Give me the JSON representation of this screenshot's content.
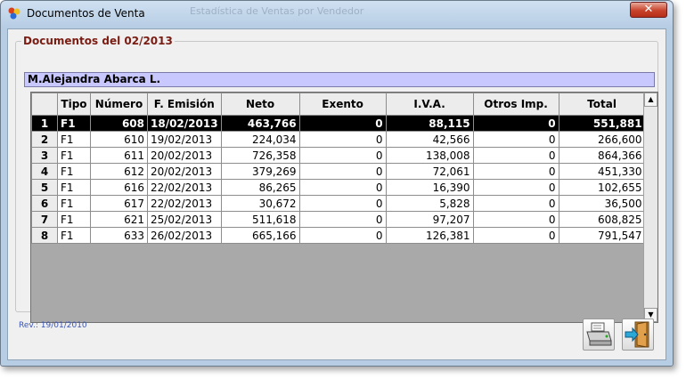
{
  "window": {
    "title": "Documentos de Venta",
    "ghost_title": "Estadística de Ventas por Vendedor"
  },
  "group": {
    "legend": "Documentos del 02/2013"
  },
  "vendor_name": "M.Alejandra Abarca L.",
  "table": {
    "headers": [
      "Tipo",
      "Número",
      "F. Emisión",
      "Neto",
      "Exento",
      "I.V.A.",
      "Otros Imp.",
      "Total"
    ],
    "rows": [
      [
        "1",
        "F1",
        "608",
        "18/02/2013",
        "463,766",
        "0",
        "88,115",
        "0",
        "551,881"
      ],
      [
        "2",
        "F1",
        "610",
        "19/02/2013",
        "224,034",
        "0",
        "42,566",
        "0",
        "266,600"
      ],
      [
        "3",
        "F1",
        "611",
        "20/02/2013",
        "726,358",
        "0",
        "138,008",
        "0",
        "864,366"
      ],
      [
        "4",
        "F1",
        "612",
        "20/02/2013",
        "379,269",
        "0",
        "72,061",
        "0",
        "451,330"
      ],
      [
        "5",
        "F1",
        "616",
        "22/02/2013",
        "86,265",
        "0",
        "16,390",
        "0",
        "102,655"
      ],
      [
        "6",
        "F1",
        "617",
        "22/02/2013",
        "30,672",
        "0",
        "5,828",
        "0",
        "36,500"
      ],
      [
        "7",
        "F1",
        "621",
        "25/02/2013",
        "511,618",
        "0",
        "97,207",
        "0",
        "608,825"
      ],
      [
        "8",
        "F1",
        "633",
        "26/02/2013",
        "665,166",
        "0",
        "126,381",
        "0",
        "791,547"
      ]
    ],
    "selected_row": 1
  },
  "revision": "Rev.: 19/01/2010",
  "icons": {
    "app": "app-icon",
    "print": "printer-icon",
    "exit": "exit-door-icon"
  },
  "colors": {
    "name_bar": "#c8c8ff",
    "legend": "#7a1c12",
    "selected_row": "#000000",
    "revision": "#3a55b5"
  }
}
